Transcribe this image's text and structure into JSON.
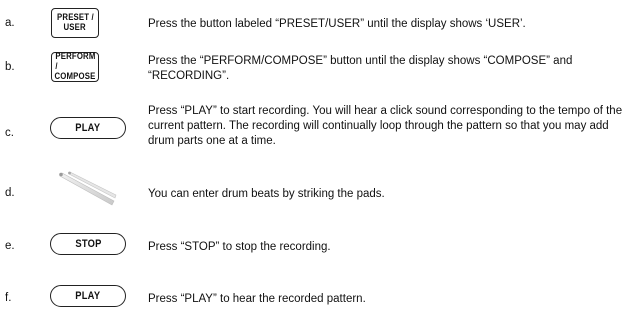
{
  "steps": [
    {
      "letter": "a.",
      "button_lines": [
        "PRESET /",
        "USER"
      ],
      "text": "Press the button labeled “PRESET/USER” until the display shows ‘USER’."
    },
    {
      "letter": "b.",
      "button_lines": [
        "PERFORM /",
        "COMPOSE"
      ],
      "text": "Press the “PERFORM/COMPOSE” button until the display shows “COMPOSE” and “RECORDING”."
    },
    {
      "letter": "c.",
      "button_label": "PLAY",
      "text": "Press “PLAY” to start recording.  You will hear a click sound corresponding to the tempo of the current pattern.  The recording will continually loop through the pattern so that you may add drum parts one at a time."
    },
    {
      "letter": "d.",
      "icon": "drumsticks-icon",
      "text": "You can enter drum beats by striking the pads."
    },
    {
      "letter": "e.",
      "button_label": "STOP",
      "text": "Press “STOP” to stop the recording."
    },
    {
      "letter": "f.",
      "button_label": "PLAY",
      "text": "Press “PLAY” to hear the recorded pattern."
    }
  ]
}
